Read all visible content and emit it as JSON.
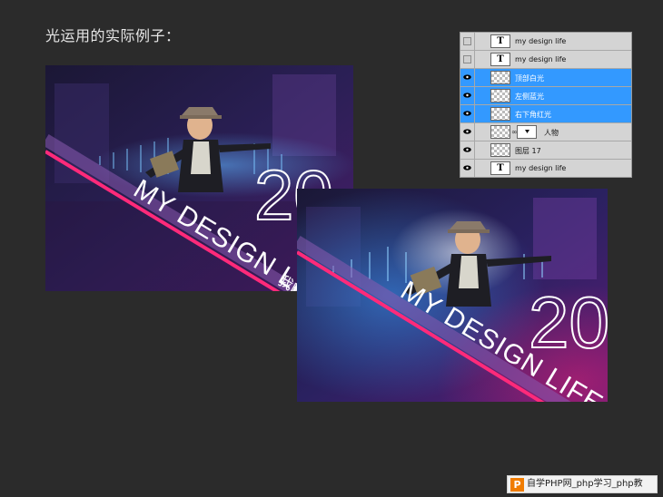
{
  "heading": "光运用的实际例子：",
  "artwork": {
    "slogan": "MY DESIGN LIFE",
    "number_fragment": "20",
    "cn_fragment": "我的"
  },
  "layers_panel": {
    "rows": [
      {
        "name": "my design life",
        "type": "text",
        "visible": false,
        "selected": false
      },
      {
        "name": "my design life",
        "type": "text",
        "visible": false,
        "selected": false
      },
      {
        "name": "顶部白光",
        "type": "raster",
        "visible": true,
        "selected": true
      },
      {
        "name": "左侧蓝光",
        "type": "raster",
        "visible": true,
        "selected": true
      },
      {
        "name": "右下角红光",
        "type": "raster",
        "visible": true,
        "selected": true
      },
      {
        "name": "人物",
        "type": "masked",
        "visible": true,
        "selected": false
      },
      {
        "name": "图层 17",
        "type": "raster",
        "visible": true,
        "selected": false
      },
      {
        "name": "my design life",
        "type": "text",
        "visible": true,
        "selected": false
      }
    ],
    "text_thumb_glyph": "T",
    "selected_color": "#3399ff"
  },
  "watermark": {
    "logo": "P",
    "text": "自学PHP网_php学习_php教"
  }
}
